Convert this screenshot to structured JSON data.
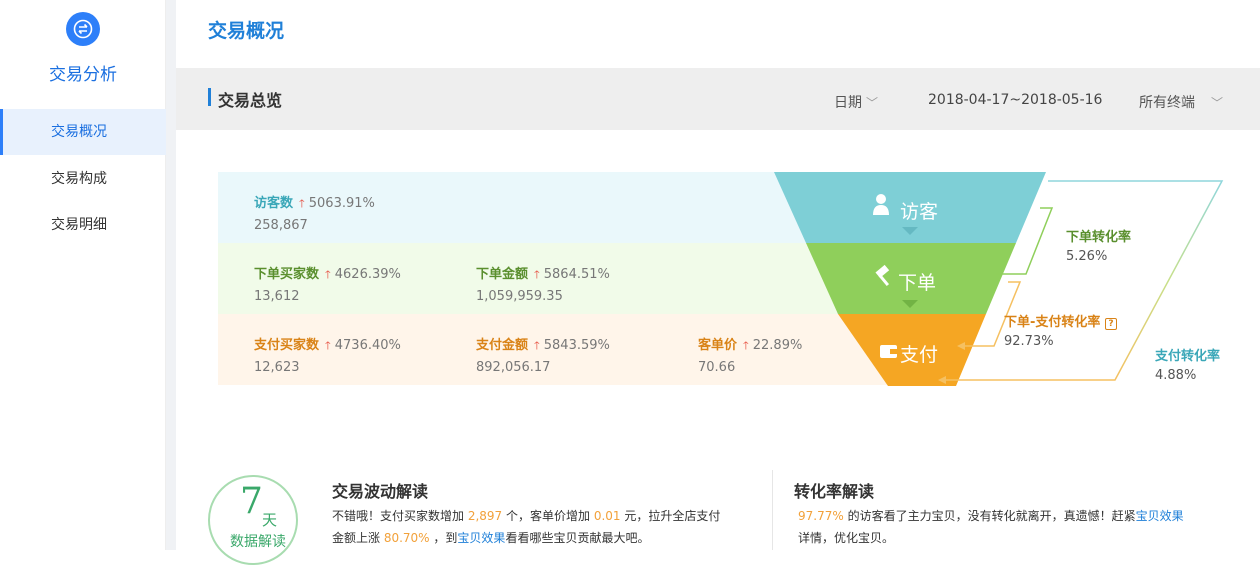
{
  "app": {
    "title": "交易分析",
    "logo_icon": "exchange-icon"
  },
  "sidebar": {
    "items": [
      {
        "label": "交易概况",
        "active": true
      },
      {
        "label": "交易构成",
        "active": false
      },
      {
        "label": "交易明细",
        "active": false
      }
    ]
  },
  "page": {
    "title": "交易概况"
  },
  "toolbar": {
    "section_title": "交易总览",
    "date_label": "日期",
    "date_range": "2018-04-17~2018-05-16",
    "terminal_label": "所有终端"
  },
  "funnel": {
    "stages": [
      {
        "label": "访客",
        "icon": "user-icon",
        "color": "#7ecfd6"
      },
      {
        "label": "下单",
        "icon": "gavel-icon",
        "color": "#8fcf5b"
      },
      {
        "label": "支付",
        "icon": "wallet-icon",
        "color": "#f5a623"
      }
    ],
    "rows": {
      "visitors": [
        {
          "label": "访客数",
          "pct": "5063.91%",
          "value": "258,867"
        }
      ],
      "orders": [
        {
          "label": "下单买家数",
          "pct": "4626.39%",
          "value": "13,612"
        },
        {
          "label": "下单金额",
          "pct": "5864.51%",
          "value": "1,059,959.35"
        }
      ],
      "payments": [
        {
          "label": "支付买家数",
          "pct": "4736.40%",
          "value": "12,623"
        },
        {
          "label": "支付金额",
          "pct": "5843.59%",
          "value": "892,056.17"
        },
        {
          "label": "客单价",
          "pct": "22.89%",
          "value": "70.66"
        }
      ]
    },
    "conversions": {
      "order_rate": {
        "label": "下单转化率",
        "value": "5.26%"
      },
      "order_pay_rate": {
        "label": "下单-支付转化率",
        "value": "92.73%"
      },
      "pay_rate": {
        "label": "支付转化率",
        "value": "4.88%"
      }
    }
  },
  "insights": {
    "badge": {
      "number": "7",
      "unit": "天",
      "caption": "数据解读"
    },
    "trade": {
      "title": "交易波动解读",
      "p1_a": "不错哦！支付买家数增加 ",
      "p1_num1": "2,897",
      "p1_b": " 个，客单价增加 ",
      "p1_num2": "0.01",
      "p1_c": " 元，拉升全店支付",
      "p2_a": "金额上涨 ",
      "p2_num": "80.70%",
      "p2_b": " ，到",
      "p2_link": "宝贝效果",
      "p2_c": "看看哪些宝贝贡献最大吧。"
    },
    "conversion": {
      "title": "转化率解读",
      "p1_num": "97.77%",
      "p1_a": " 的访客看了主力宝贝，没有转化就离开，真遗憾！赶紧",
      "p1_link": "宝贝效果",
      "p2": "详情，优化宝贝。"
    }
  }
}
